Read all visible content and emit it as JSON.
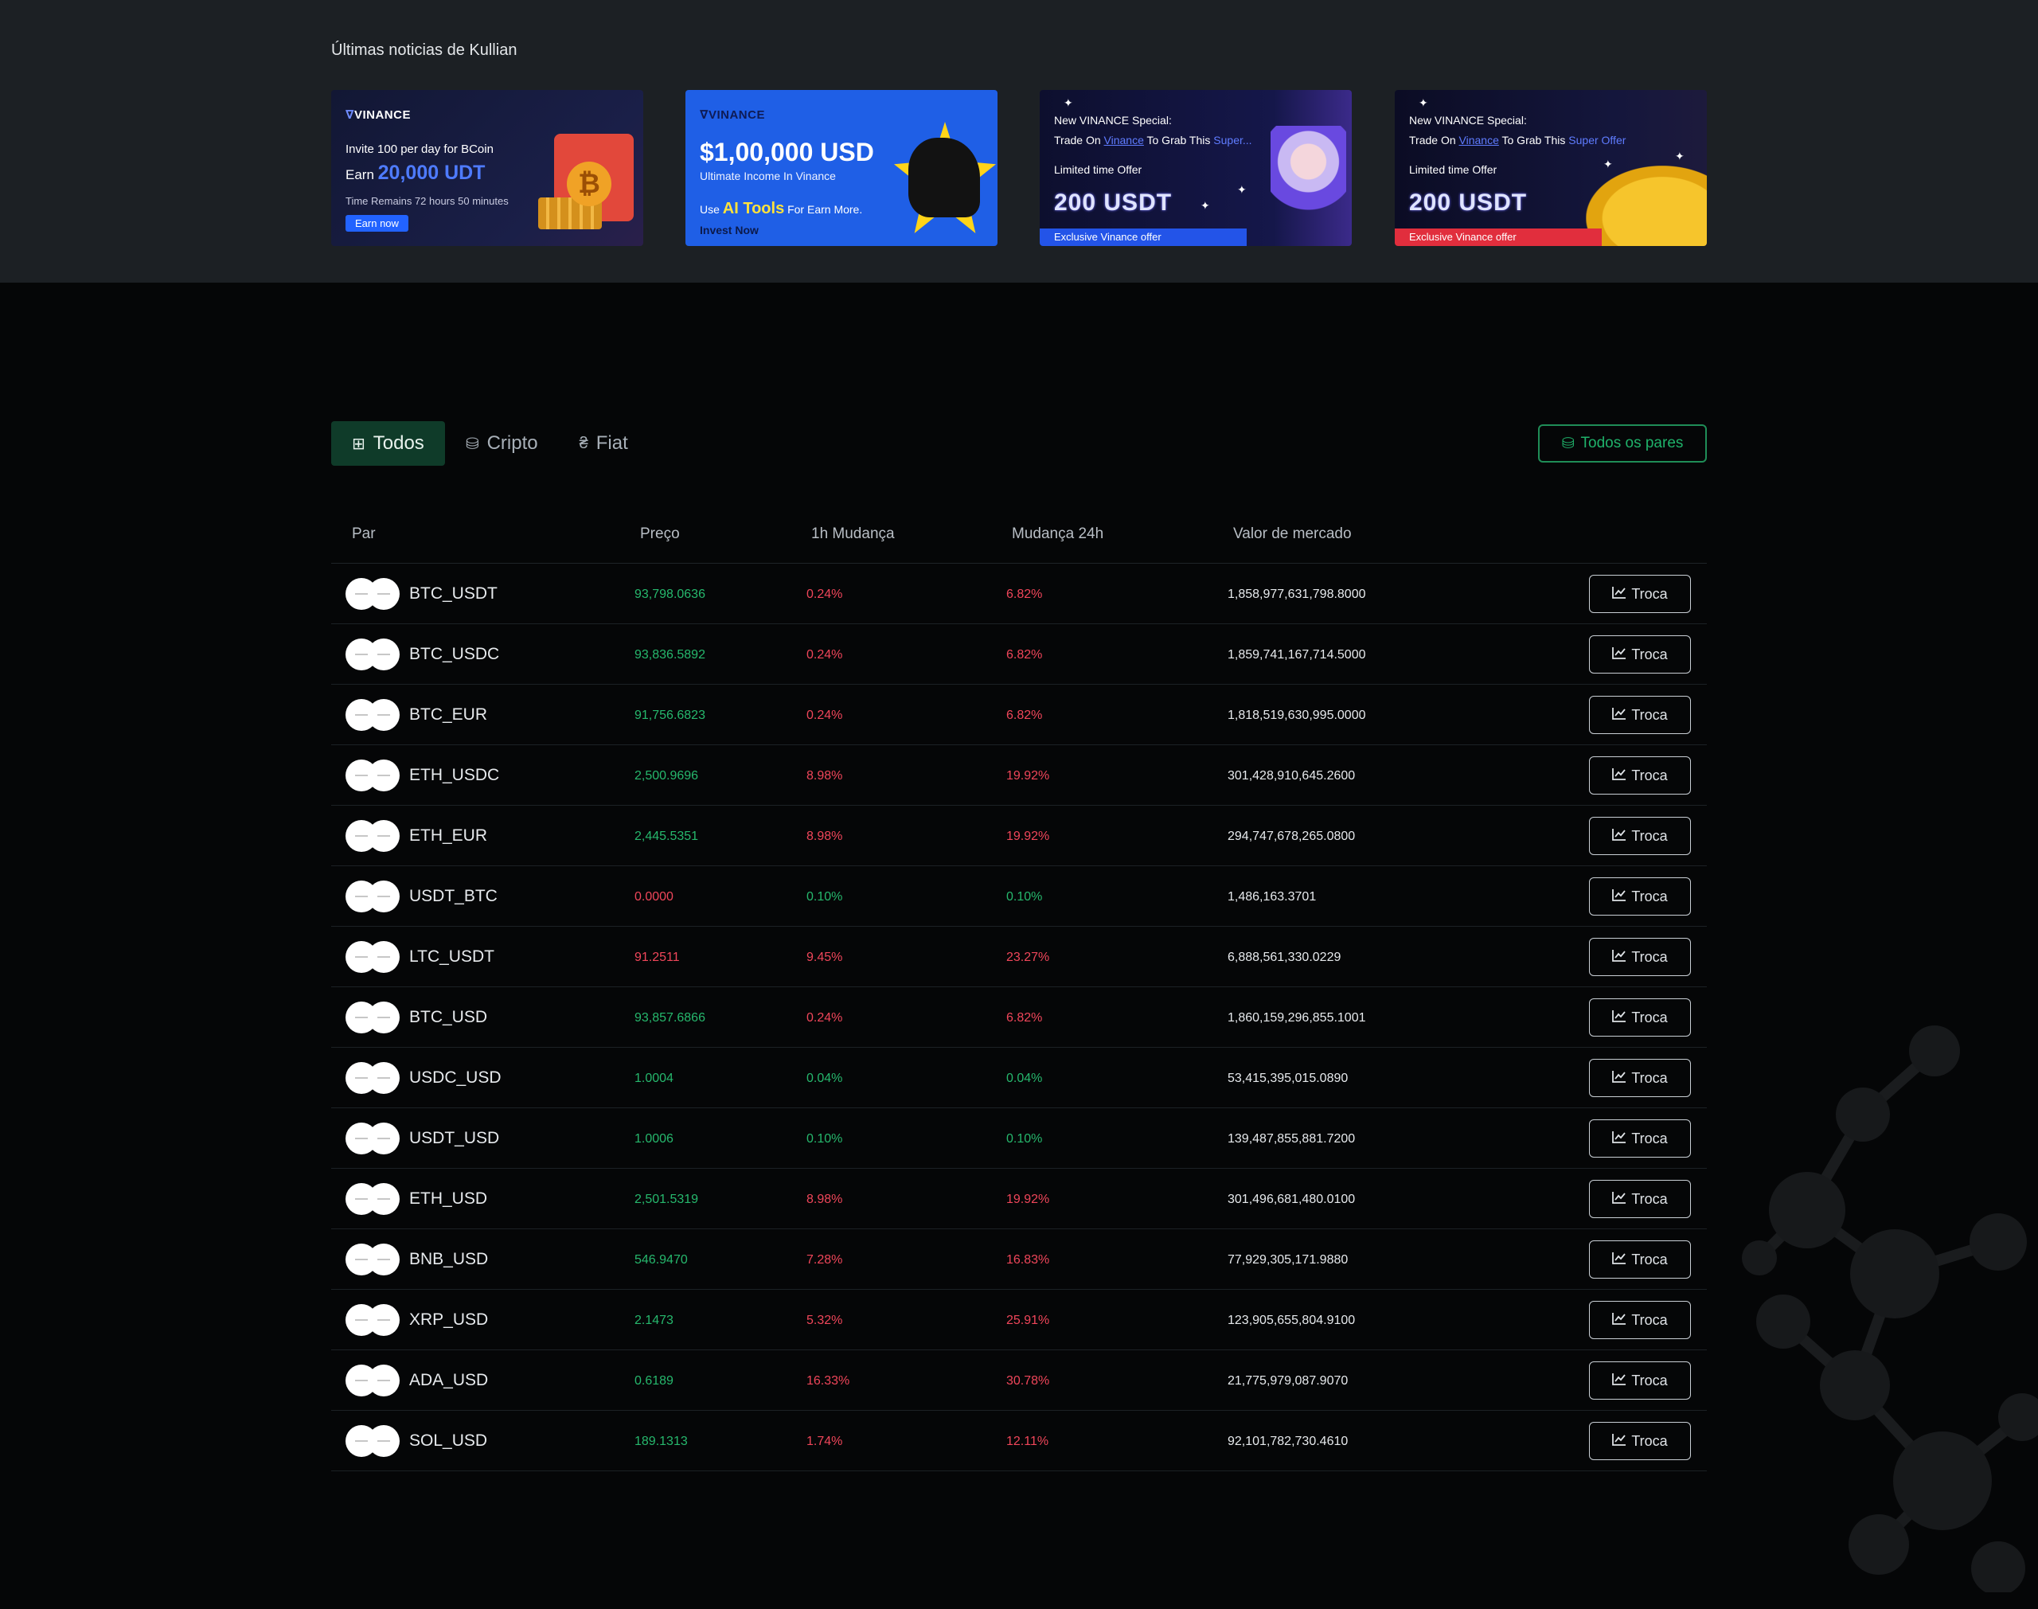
{
  "news": {
    "title": "Últimas noticias de Kullian",
    "banners": [
      {
        "logo": "VINANCE",
        "line1": "Invite 100 per day for BCoin",
        "earn_prefix": "Earn",
        "earn_amount": "20,000 UDT",
        "line3": "Time Remains 72 hours 50 minutes",
        "button": "Earn now"
      },
      {
        "logo": "VINANCE",
        "headline": "$1,00,000 USD",
        "line2": "Ultimate Income In Vinance",
        "use_prefix": "Use",
        "ai_tools": "AI Tools",
        "use_suffix": "For Earn More.",
        "cta": "Invest Now"
      },
      {
        "line1": "New VINANCE Special:",
        "line2_a": "Trade On",
        "line2_hl": "Vinance",
        "line2_b": "To Grab This",
        "line2_c": "Super...",
        "line3": "Limited time Offer",
        "amount": "200 USDT",
        "bar": "Exclusive Vinance offer"
      },
      {
        "line1": "New VINANCE Special:",
        "line2_a": "Trade On",
        "line2_hl": "Vinance",
        "line2_b": "To Grab This",
        "line2_c": "Super Offer",
        "line3": "Limited time Offer",
        "amount": "200 USDT",
        "bar": "Exclusive Vinance offer"
      }
    ]
  },
  "tabs": [
    {
      "label": "Todos",
      "icon": "grid-icon",
      "active": true
    },
    {
      "label": "Cripto",
      "icon": "coins-icon",
      "active": false
    },
    {
      "label": "Fiat",
      "icon": "currency-icon",
      "active": false
    }
  ],
  "all_pairs_button": "Todos os pares",
  "table": {
    "headers": {
      "pair": "Par",
      "price": "Preço",
      "change_1h": "1h Mudança",
      "change_24h": "Mudança 24h",
      "market_cap": "Valor de mercado"
    },
    "trade_label": "Troca",
    "rows": [
      {
        "pair": "BTC_USDT",
        "price": "93,798.0636",
        "price_color": "green",
        "h1": "0.24%",
        "h1_color": "red",
        "h24": "6.82%",
        "h24_color": "red",
        "mcap": "1,858,977,631,798.8000"
      },
      {
        "pair": "BTC_USDC",
        "price": "93,836.5892",
        "price_color": "green",
        "h1": "0.24%",
        "h1_color": "red",
        "h24": "6.82%",
        "h24_color": "red",
        "mcap": "1,859,741,167,714.5000"
      },
      {
        "pair": "BTC_EUR",
        "price": "91,756.6823",
        "price_color": "green",
        "h1": "0.24%",
        "h1_color": "red",
        "h24": "6.82%",
        "h24_color": "red",
        "mcap": "1,818,519,630,995.0000"
      },
      {
        "pair": "ETH_USDC",
        "price": "2,500.9696",
        "price_color": "green",
        "h1": "8.98%",
        "h1_color": "red",
        "h24": "19.92%",
        "h24_color": "red",
        "mcap": "301,428,910,645.2600"
      },
      {
        "pair": "ETH_EUR",
        "price": "2,445.5351",
        "price_color": "green",
        "h1": "8.98%",
        "h1_color": "red",
        "h24": "19.92%",
        "h24_color": "red",
        "mcap": "294,747,678,265.0800"
      },
      {
        "pair": "USDT_BTC",
        "price": "0.0000",
        "price_color": "red",
        "h1": "0.10%",
        "h1_color": "green",
        "h24": "0.10%",
        "h24_color": "green",
        "mcap": "1,486,163.3701"
      },
      {
        "pair": "LTC_USDT",
        "price": "91.2511",
        "price_color": "red",
        "h1": "9.45%",
        "h1_color": "red",
        "h24": "23.27%",
        "h24_color": "red",
        "mcap": "6,888,561,330.0229"
      },
      {
        "pair": "BTC_USD",
        "price": "93,857.6866",
        "price_color": "green",
        "h1": "0.24%",
        "h1_color": "red",
        "h24": "6.82%",
        "h24_color": "red",
        "mcap": "1,860,159,296,855.1001"
      },
      {
        "pair": "USDC_USD",
        "price": "1.0004",
        "price_color": "green",
        "h1": "0.04%",
        "h1_color": "green",
        "h24": "0.04%",
        "h24_color": "green",
        "mcap": "53,415,395,015.0890"
      },
      {
        "pair": "USDT_USD",
        "price": "1.0006",
        "price_color": "green",
        "h1": "0.10%",
        "h1_color": "green",
        "h24": "0.10%",
        "h24_color": "green",
        "mcap": "139,487,855,881.7200"
      },
      {
        "pair": "ETH_USD",
        "price": "2,501.5319",
        "price_color": "green",
        "h1": "8.98%",
        "h1_color": "red",
        "h24": "19.92%",
        "h24_color": "red",
        "mcap": "301,496,681,480.0100"
      },
      {
        "pair": "BNB_USD",
        "price": "546.9470",
        "price_color": "green",
        "h1": "7.28%",
        "h1_color": "red",
        "h24": "16.83%",
        "h24_color": "red",
        "mcap": "77,929,305,171.9880"
      },
      {
        "pair": "XRP_USD",
        "price": "2.1473",
        "price_color": "green",
        "h1": "5.32%",
        "h1_color": "red",
        "h24": "25.91%",
        "h24_color": "red",
        "mcap": "123,905,655,804.9100"
      },
      {
        "pair": "ADA_USD",
        "price": "0.6189",
        "price_color": "green",
        "h1": "16.33%",
        "h1_color": "red",
        "h24": "30.78%",
        "h24_color": "red",
        "mcap": "21,775,979,087.9070"
      },
      {
        "pair": "SOL_USD",
        "price": "189.1313",
        "price_color": "green",
        "h1": "1.74%",
        "h1_color": "red",
        "h24": "12.11%",
        "h24_color": "red",
        "mcap": "92,101,782,730.4610"
      }
    ]
  },
  "colors": {
    "green": "#26b86d",
    "red": "#f0465a",
    "accent_green": "#1f8d57",
    "active_tab_bg": "#0f3b29"
  }
}
